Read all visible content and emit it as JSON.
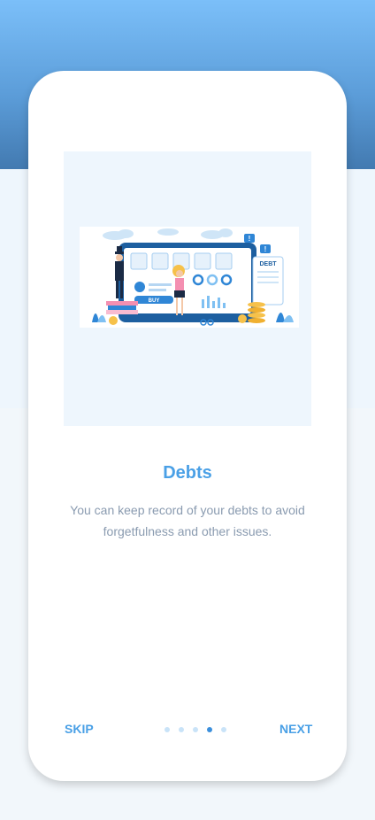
{
  "slide": {
    "title": "Debts",
    "description": "You can keep record of your debts to avoid forgetfulness and other issues."
  },
  "illustration": {
    "buy_label": "BUY",
    "debt_label": "DEBT",
    "alert_mark": "!"
  },
  "navigation": {
    "skip_label": "SKIP",
    "next_label": "NEXT",
    "page_count": 5,
    "active_index": 3
  },
  "colors": {
    "accent": "#4aa0e6",
    "active_dot": "#3b8fdc",
    "inactive_dot": "#c9e3f8",
    "text_muted": "#8a9bb0"
  }
}
